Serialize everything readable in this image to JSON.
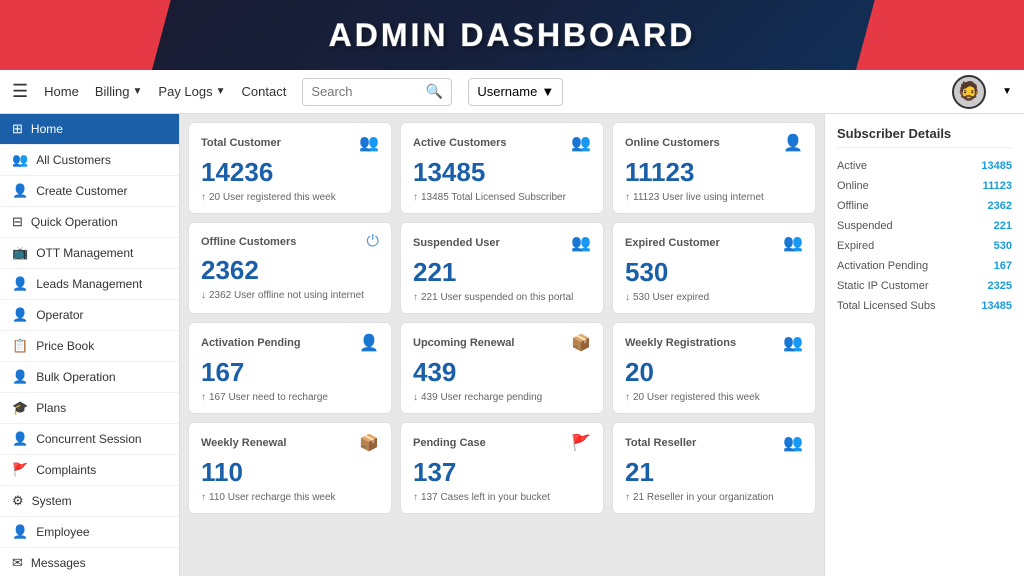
{
  "header": {
    "title": "Admin Dashboard"
  },
  "navbar": {
    "home_label": "Home",
    "billing_label": "Billing",
    "paylogs_label": "Pay Logs",
    "contact_label": "Contact",
    "search_placeholder": "Search",
    "username_label": "Username",
    "hamburger_icon": "☰"
  },
  "sidebar": {
    "items": [
      {
        "id": "home",
        "label": "Home",
        "icon": "⊞",
        "active": true
      },
      {
        "id": "all-customers",
        "label": "All Customers",
        "icon": "👥"
      },
      {
        "id": "create-customer",
        "label": "Create Customer",
        "icon": "👤"
      },
      {
        "id": "quick-operation",
        "label": "Quick Operation",
        "icon": "⊟"
      },
      {
        "id": "ott-management",
        "label": "OTT Management",
        "icon": "📺"
      },
      {
        "id": "leads-management",
        "label": "Leads Management",
        "icon": "👤"
      },
      {
        "id": "operator",
        "label": "Operator",
        "icon": "👤"
      },
      {
        "id": "price-book",
        "label": "Price Book",
        "icon": "📋"
      },
      {
        "id": "bulk-operation",
        "label": "Bulk Operation",
        "icon": "👤"
      },
      {
        "id": "plans",
        "label": "Plans",
        "icon": "🎓"
      },
      {
        "id": "concurrent-session",
        "label": "Concurrent Session",
        "icon": "👤"
      },
      {
        "id": "complaints",
        "label": "Complaints",
        "icon": "🚩"
      },
      {
        "id": "system",
        "label": "System",
        "icon": "⚙"
      },
      {
        "id": "employee",
        "label": "Employee",
        "icon": "👤"
      },
      {
        "id": "messages",
        "label": "Messages",
        "icon": "✉"
      }
    ]
  },
  "cards": [
    {
      "title": "Total Customer",
      "value": "14236",
      "subtitle": "20 User registered this week",
      "trend": "up",
      "icon": "👥"
    },
    {
      "title": "Active Customers",
      "value": "13485",
      "subtitle": "13485 Total Licensed Subscriber",
      "trend": "up",
      "icon": "👥"
    },
    {
      "title": "Online Customers",
      "value": "11123",
      "subtitle": "11123 User live using internet",
      "trend": "up",
      "icon": "👤"
    },
    {
      "title": "Offline Customers",
      "value": "2362",
      "subtitle": "2362 User offline not using internet",
      "trend": "down",
      "icon": "⏻"
    },
    {
      "title": "Suspended User",
      "value": "221",
      "subtitle": "221 User suspended on this portal",
      "trend": "up",
      "icon": "👥"
    },
    {
      "title": "Expired Customer",
      "value": "530",
      "subtitle": "530 User expired",
      "trend": "down",
      "icon": "👥"
    },
    {
      "title": "Activation Pending",
      "value": "167",
      "subtitle": "167 User need to recharge",
      "trend": "up",
      "icon": "👤"
    },
    {
      "title": "Upcoming Renewal",
      "value": "439",
      "subtitle": "439 User recharge pending",
      "trend": "down",
      "icon": "📦"
    },
    {
      "title": "Weekly Registrations",
      "value": "20",
      "subtitle": "20 User registered this week",
      "trend": "up",
      "icon": "👥"
    },
    {
      "title": "Weekly Renewal",
      "value": "110",
      "subtitle": "110 User recharge this week",
      "trend": "up",
      "icon": "📦"
    },
    {
      "title": "Pending Case",
      "value": "137",
      "subtitle": "137 Cases left in your bucket",
      "trend": "up",
      "icon": "🚩"
    },
    {
      "title": "Total Reseller",
      "value": "21",
      "subtitle": "21 Reseller in your organization",
      "trend": "up",
      "icon": "👥"
    }
  ],
  "subscriber_details": {
    "title": "Subscriber Details",
    "rows": [
      {
        "label": "Active",
        "value": "13485"
      },
      {
        "label": "Online",
        "value": "11123"
      },
      {
        "label": "Offline",
        "value": "2362"
      },
      {
        "label": "Suspended",
        "value": "221"
      },
      {
        "label": "Expired",
        "value": "530"
      },
      {
        "label": "Activation Pending",
        "value": "167"
      },
      {
        "label": "Static IP Customer",
        "value": "2325"
      },
      {
        "label": "Total Licensed Subs",
        "value": "13485"
      }
    ]
  }
}
